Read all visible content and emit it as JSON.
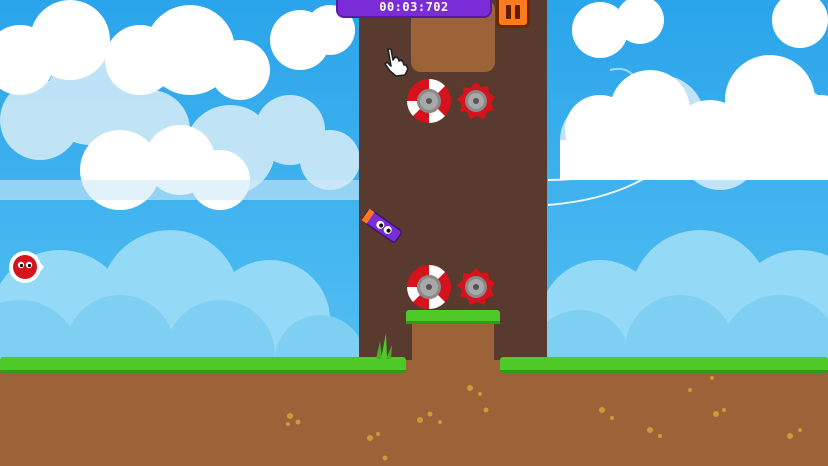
{
  "hud": {
    "timer": "00:03:702",
    "pause_icon": "pause-icon"
  },
  "colors": {
    "sky": "#3cb1ee",
    "tower": "#583a2e",
    "dirt": "#9b6337",
    "grass": "#4fc928",
    "saw_red": "#d6121d",
    "timer_purple": "#7a2cd6",
    "pause_orange": "#ff7a1a"
  },
  "entities": [
    {
      "name": "red-ball-player",
      "kind": "player"
    },
    {
      "name": "purple-stick-creature",
      "kind": "character"
    },
    {
      "name": "pointer-hand",
      "kind": "cursor"
    }
  ]
}
